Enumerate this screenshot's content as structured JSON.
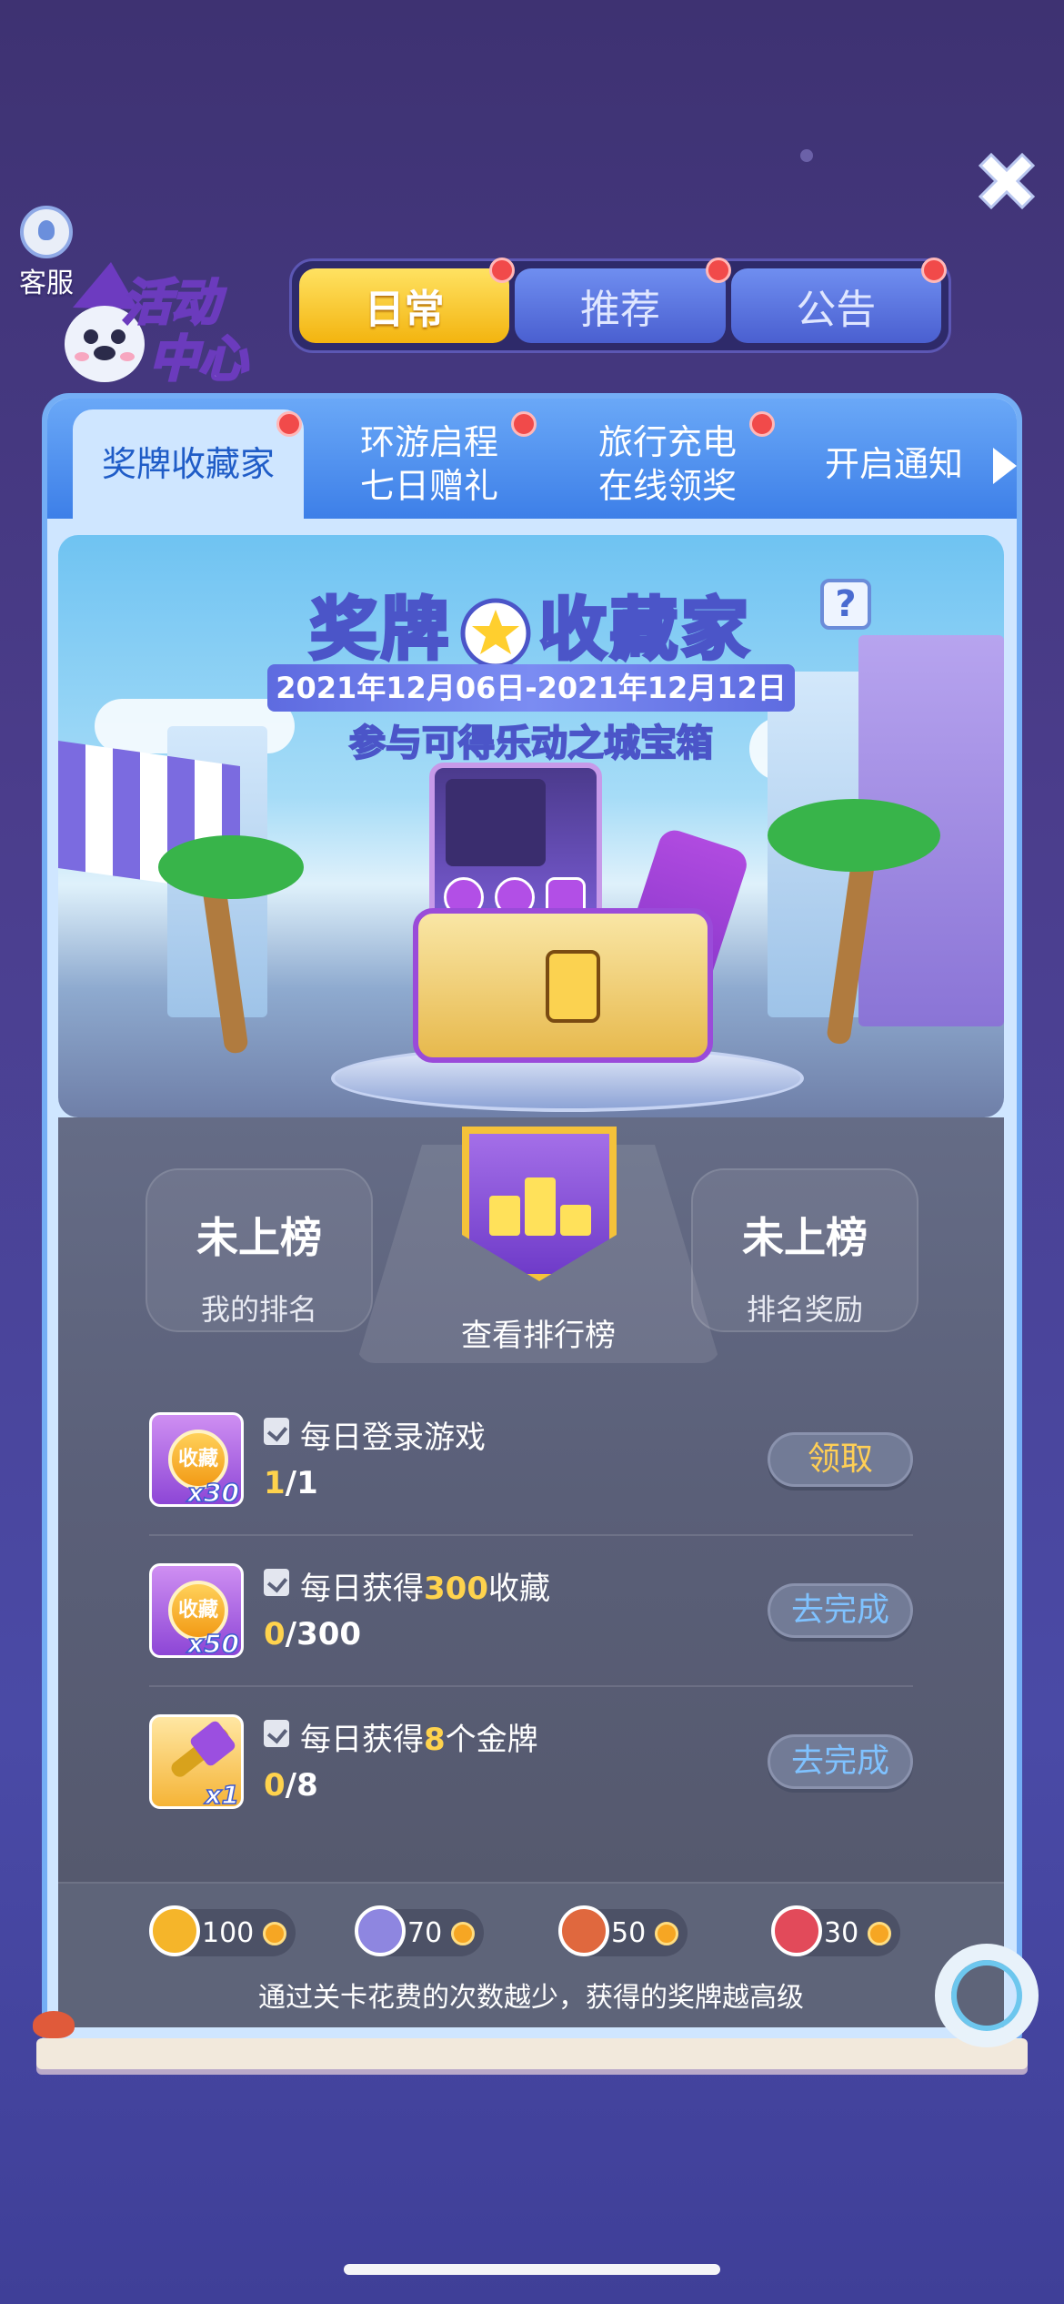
{
  "support": {
    "label": "客服"
  },
  "logo": {
    "line1": "活动",
    "line2": "中心"
  },
  "top_tabs": [
    {
      "label": "日常",
      "active": true,
      "badge": true
    },
    {
      "label": "推荐",
      "active": false,
      "badge": true
    },
    {
      "label": "公告",
      "active": false,
      "badge": true
    }
  ],
  "sub_tabs": [
    {
      "label": "奖牌收藏家",
      "active": true,
      "badge": true
    },
    {
      "label": "环游启程\n七日赠礼",
      "active": false,
      "badge": true
    },
    {
      "label": "旅行充电\n在线领奖",
      "active": false,
      "badge": true
    },
    {
      "label": "开启通知",
      "active": false,
      "badge": false
    }
  ],
  "banner": {
    "title_left": "奖牌",
    "title_right": "收藏家",
    "date_range": "2021年12月06日-2021年12月12日",
    "subtitle": "参与可得乐动之城宝箱",
    "help": "?"
  },
  "ranking": {
    "my_rank_value": "未上榜",
    "my_rank_label": "我的排名",
    "view_leaderboard": "查看排行榜",
    "reward_value": "未上榜",
    "reward_label": "排名奖励"
  },
  "tasks": [
    {
      "icon": "collection-coin",
      "icon_text": "收藏",
      "qty": "x30",
      "title_pre": "每日登录游戏",
      "title_hl": "",
      "title_post": "",
      "prog_done": "1",
      "prog_total": "/1",
      "button": "领取",
      "button_type": "claim"
    },
    {
      "icon": "collection-coin",
      "icon_text": "收藏",
      "qty": "x50",
      "title_pre": "每日获得",
      "title_hl": "300",
      "title_post": "收藏",
      "prog_done": "0",
      "prog_total": "/300",
      "button": "去完成",
      "button_type": "go"
    },
    {
      "icon": "key",
      "icon_text": "",
      "qty": "x1",
      "title_pre": "每日获得",
      "title_hl": "8",
      "title_post": "个金牌",
      "prog_done": "0",
      "prog_total": "/8",
      "button": "去完成",
      "button_type": "go"
    }
  ],
  "medals": [
    {
      "type": "gold-medal",
      "value": "100",
      "color": "#f5b52a"
    },
    {
      "type": "silver-medal",
      "value": "70",
      "color": "#8e86e0"
    },
    {
      "type": "bronze-medal",
      "value": "50",
      "color": "#e0683e"
    },
    {
      "type": "red-medal",
      "value": "30",
      "color": "#e24a5a"
    }
  ],
  "medals_note": "通过关卡花费的次数越少，获得的奖牌越高级",
  "colors": {
    "accent_yellow": "#f3b40f",
    "tab_blue": "#4a5fd0",
    "badge_red": "#f14a4a",
    "highlight": "#ffd34d"
  }
}
